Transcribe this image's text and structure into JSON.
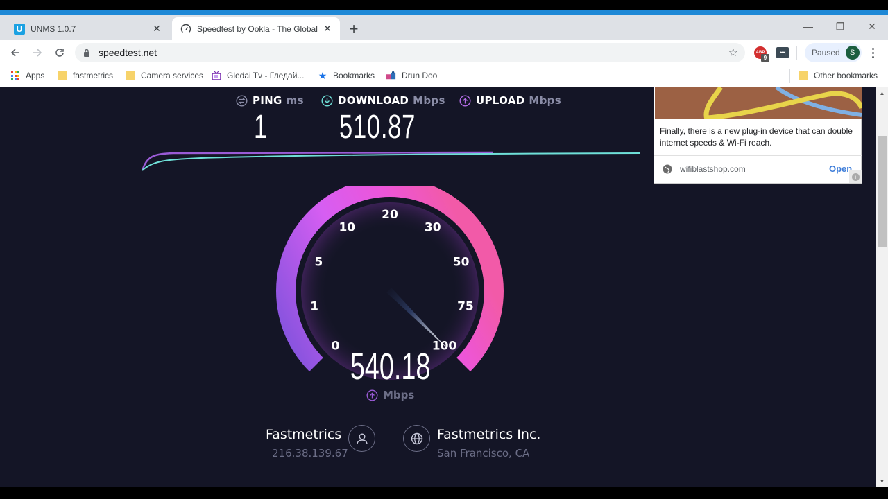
{
  "browser": {
    "tabs": [
      {
        "title": "UNMS 1.0.7",
        "icon": "unms-logo-icon",
        "icon_text": "U",
        "active": false
      },
      {
        "title": "Speedtest by Ookla - The Global",
        "icon": "speedometer-icon",
        "active": true
      }
    ],
    "new_tab_label": "+",
    "window_controls": {
      "minimize": "—",
      "restore": "❐",
      "close": "✕"
    },
    "url": "speedtest.net",
    "extensions": {
      "adblock_label": "ABP",
      "adblock_badge": "9",
      "password_label": "•••|"
    },
    "profile": {
      "status": "Paused",
      "initial": "S",
      "avatar_color": "#1b5e3f"
    },
    "bookmarks": [
      {
        "label": "Apps",
        "icon": "apps-grid-icon"
      },
      {
        "label": "fastmetrics",
        "icon": "folder-icon"
      },
      {
        "label": "Camera services",
        "icon": "folder-icon"
      },
      {
        "label": "Gledai Tv - Гледай...",
        "icon": "tv-icon"
      },
      {
        "label": "Bookmarks",
        "icon": "star-icon"
      },
      {
        "label": "Drun Doo",
        "icon": "site-icon"
      }
    ],
    "other_bookmarks": "Other bookmarks",
    "accent_color": "#1e88d6"
  },
  "speedtest": {
    "ping": {
      "label": "PING",
      "unit": "ms",
      "value": "1"
    },
    "download": {
      "label": "DOWNLOAD",
      "unit": "Mbps",
      "value": "510.87",
      "color": "#6fe0d8"
    },
    "upload": {
      "label": "UPLOAD",
      "unit": "Mbps",
      "value": "",
      "color": "#b46ce6"
    },
    "gauge": {
      "ticks": [
        "0",
        "1",
        "5",
        "10",
        "20",
        "30",
        "50",
        "75",
        "100"
      ],
      "current_value": "540.18",
      "needle_tick_fraction": 1.0,
      "unit": "Mbps",
      "mode": "upload",
      "gradient_start": "#8455e0",
      "gradient_mid": "#e85ef0",
      "gradient_end": "#f25aa8"
    },
    "isp": {
      "name": "Fastmetrics",
      "ip": "216.38.139.67"
    },
    "server": {
      "name": "Fastmetrics Inc.",
      "location": "San Francisco, CA"
    }
  },
  "ad": {
    "text": "Finally, there is a new plug-in device that can double internet speeds & Wi-Fi reach.",
    "domain": "wifiblastshop.com",
    "cta": "Open",
    "info_label": "i"
  }
}
